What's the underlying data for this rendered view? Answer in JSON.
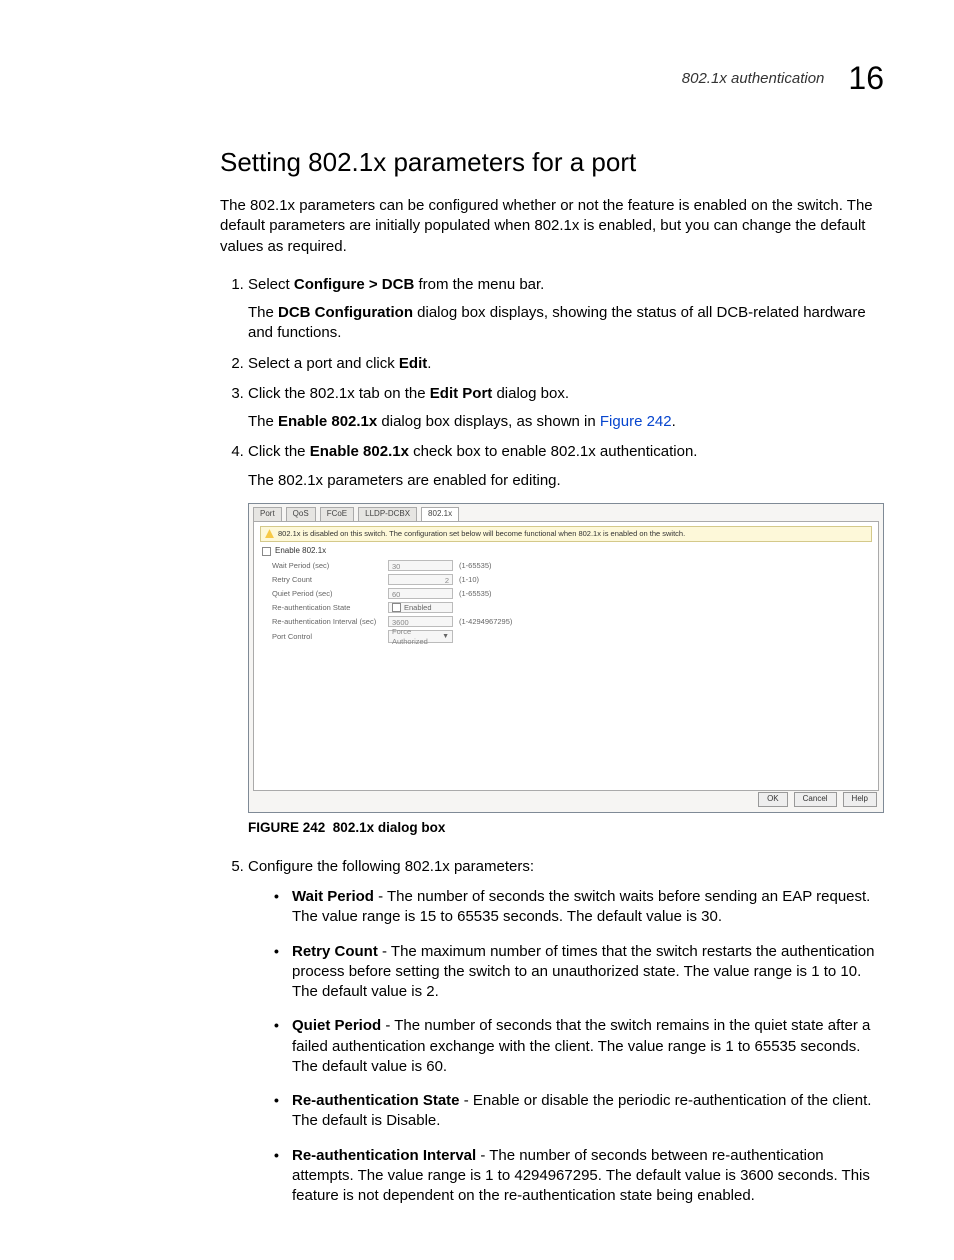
{
  "header": {
    "section_label": "802.1x authentication",
    "chapter_number": "16"
  },
  "title": "Setting 802.1x parameters for a port",
  "intro": "The 802.1x parameters can be configured whether or not the feature is enabled on the switch. The default parameters are initially populated when 802.1x is enabled, but you can change the default values as required.",
  "steps": {
    "s1_a": "Select ",
    "s1_b": "Configure > DCB",
    "s1_c": " from the menu bar.",
    "s1_sub_a": "The ",
    "s1_sub_b": "DCB Configuration",
    "s1_sub_c": " dialog box displays, showing the status of all DCB-related hardware and functions.",
    "s2_a": "Select a port and click ",
    "s2_b": "Edit",
    "s2_c": ".",
    "s3_a": "Click the 802.1x tab on the ",
    "s3_b": "Edit Port",
    "s3_c": " dialog box.",
    "s3_sub_a": "The ",
    "s3_sub_b": "Enable 802.1x",
    "s3_sub_c": " dialog box displays, as shown in ",
    "s3_sub_link": "Figure 242",
    "s3_sub_d": ".",
    "s4_a": "Click the ",
    "s4_b": "Enable 802.1x",
    "s4_c": " check box to enable 802.1x authentication.",
    "s4_sub": "The 802.1x parameters are enabled for editing.",
    "s5": "Configure the following 802.1x parameters:"
  },
  "dialog": {
    "tabs": {
      "t1": "Port",
      "t2": "QoS",
      "t3": "FCoE",
      "t4": "LLDP-DCBX",
      "t5": "802.1x"
    },
    "warn": "802.1x is disabled on this switch. The configuration set below will become functional when 802.1x is enabled on the switch.",
    "enable_label": "Enable 802.1x",
    "rows": {
      "wait_label": "Wait Period (sec)",
      "wait_val": "30",
      "wait_range": "(1-65535)",
      "retry_label": "Retry Count",
      "retry_val": "2",
      "retry_range": "(1-10)",
      "quiet_label": "Quiet Period (sec)",
      "quiet_val": "60",
      "quiet_range": "(1-65535)",
      "reauth_state_label": "Re-authentication State",
      "reauth_state_val": "Enabled",
      "reauth_int_label": "Re-authentication Interval (sec)",
      "reauth_int_val": "3600",
      "reauth_int_range": "(1-4294967295)",
      "portctl_label": "Port Control",
      "portctl_val": "Force Authorized"
    },
    "buttons": {
      "ok": "OK",
      "cancel": "Cancel",
      "help": "Help"
    }
  },
  "figure": {
    "label": "FIGURE 242",
    "caption": "802.1x dialog box"
  },
  "params": {
    "wait_b": "Wait Period",
    "wait_t": " - The number of seconds the switch waits before sending an EAP request. The value range is 15 to 65535 seconds. The default value is 30.",
    "retry_b": "Retry Count",
    "retry_t": " - The maximum number of times that the switch restarts the authentication process before setting the switch to an unauthorized state. The value range is 1 to 10. The default value is 2.",
    "quiet_b": "Quiet Period",
    "quiet_t": " - The number of seconds that the switch remains in the quiet state after a failed authentication exchange with the client. The value range is 1 to 65535 seconds. The default value is 60.",
    "rs_b": "Re-authentication State",
    "rs_t": " - Enable or disable the periodic re-authentication of the client. The default is Disable.",
    "ri_b": "Re-authentication Interval",
    "ri_t": " - The number of seconds between re-authentication attempts. The value range is 1 to 4294967295. The default value is 3600 seconds. This feature is not dependent on the re-authentication state being enabled."
  }
}
